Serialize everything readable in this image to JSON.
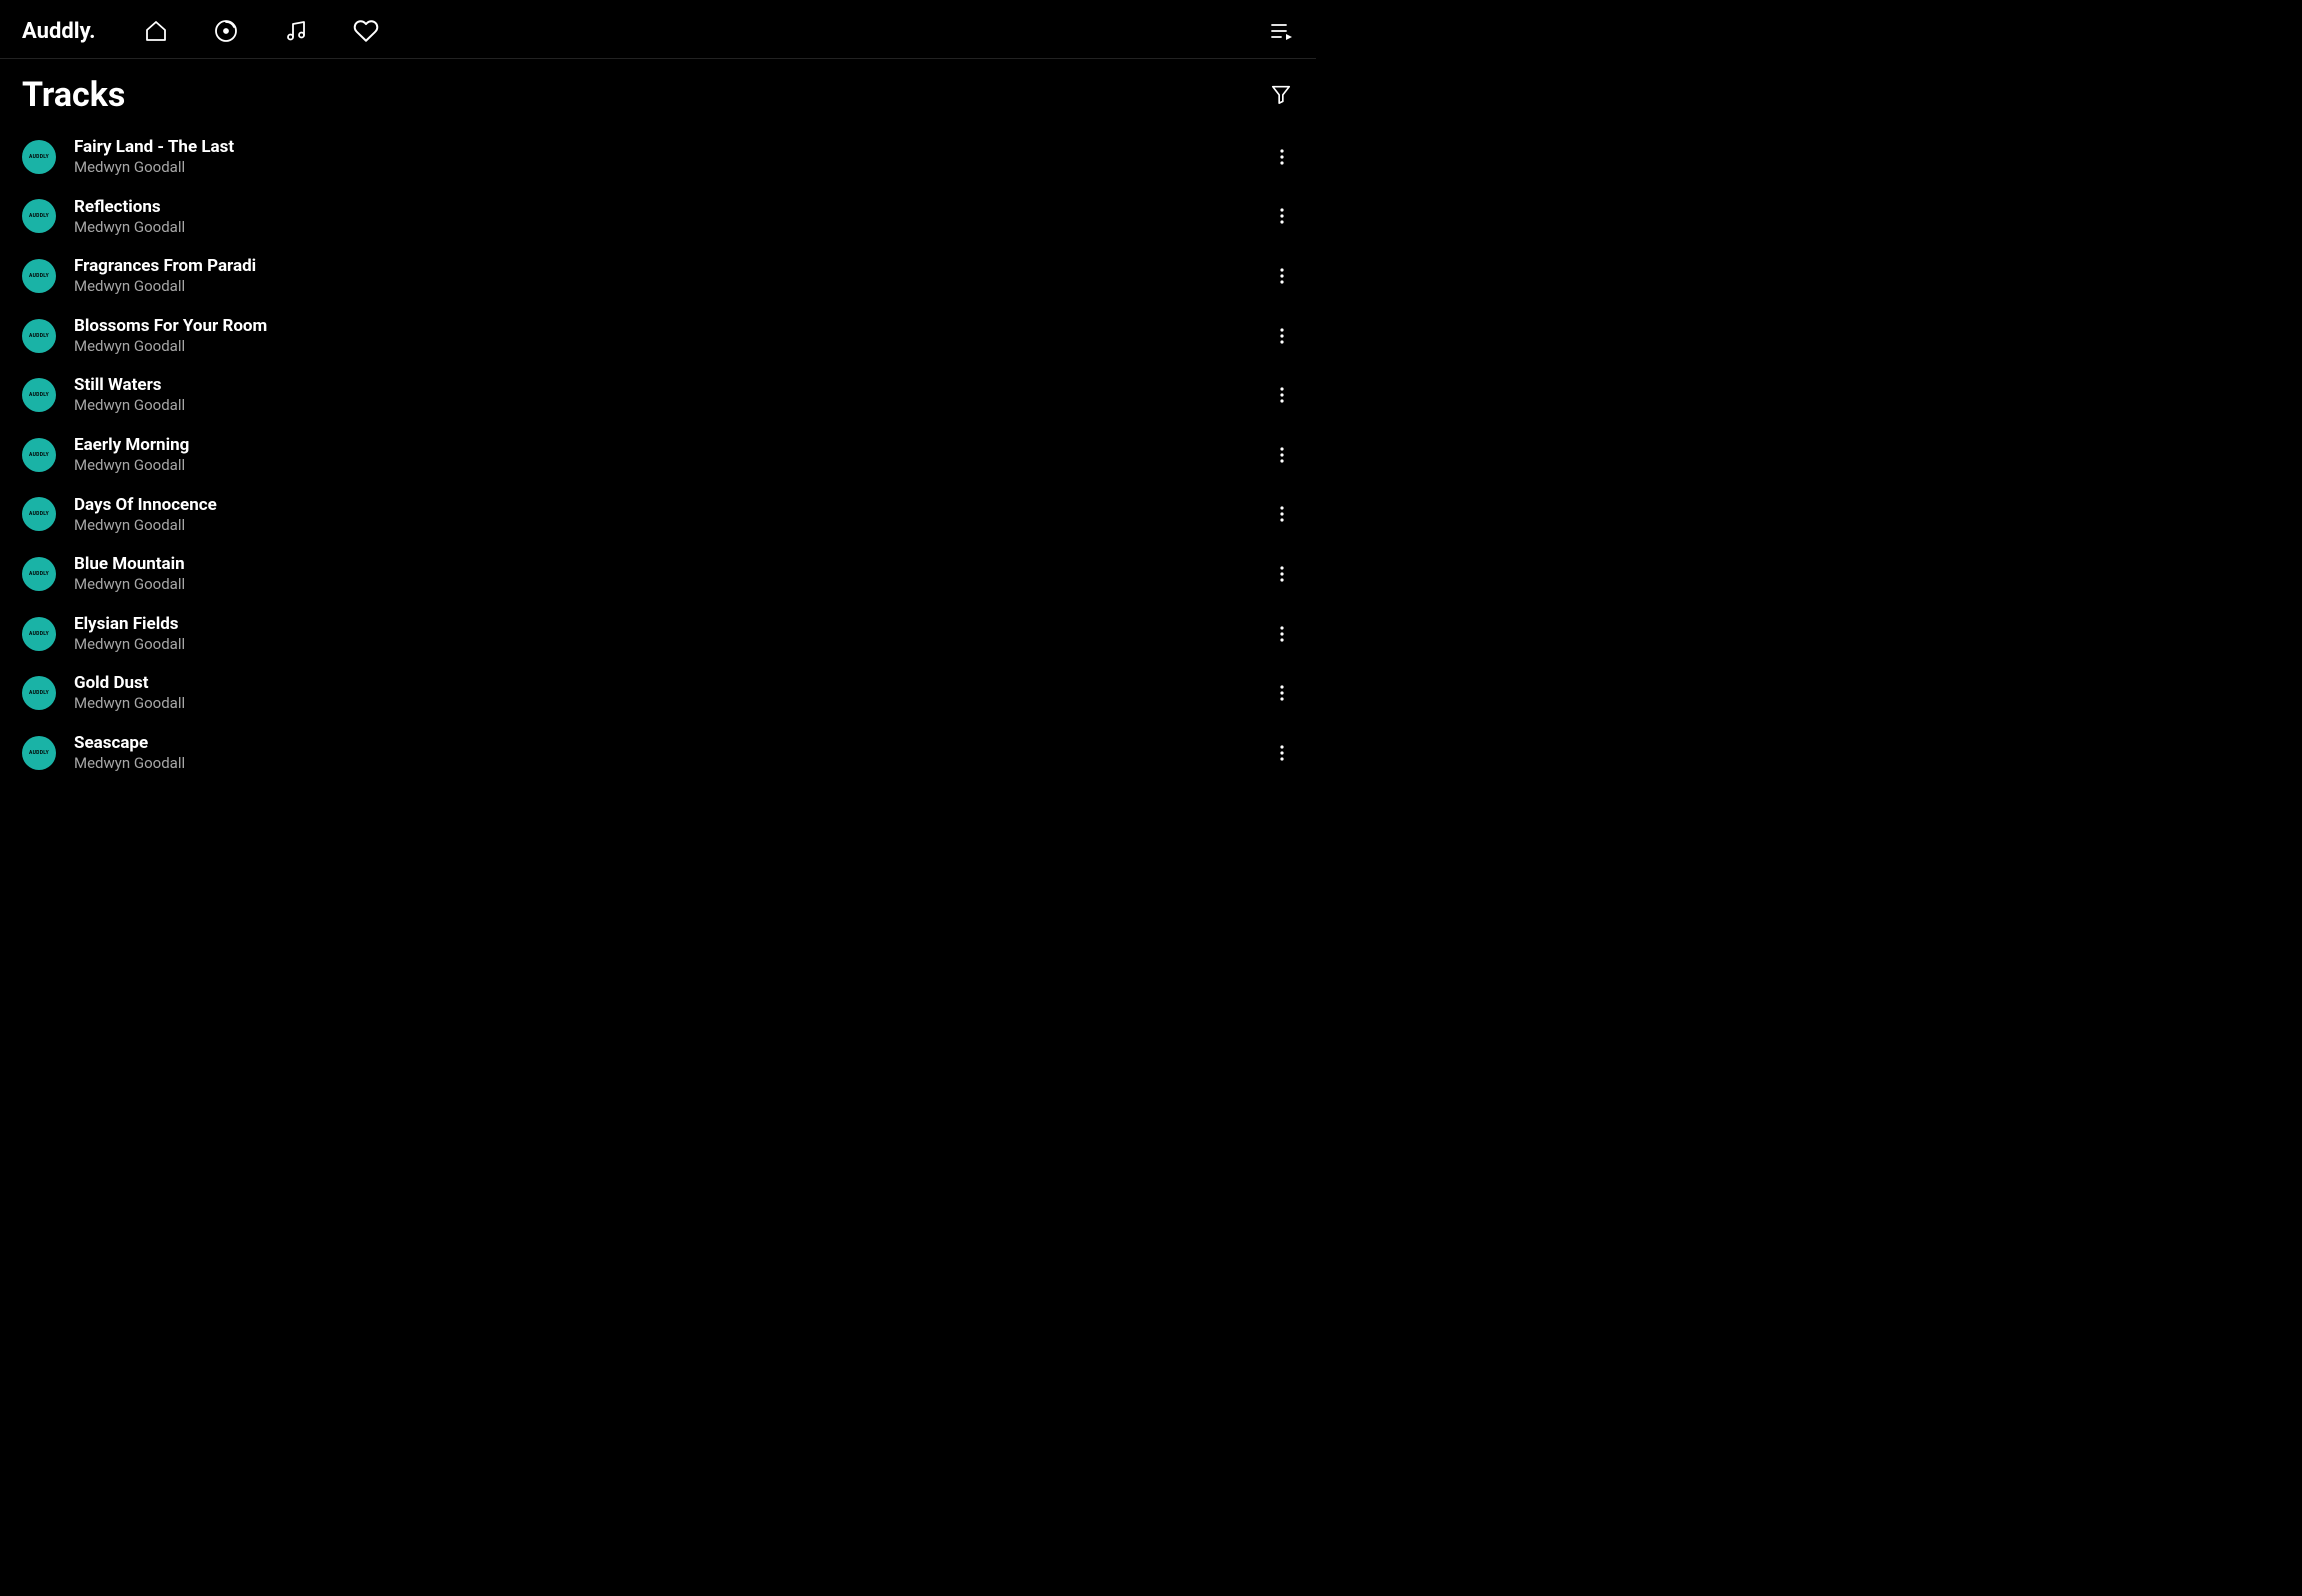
{
  "logo": "Auddly.",
  "page_title": "Tracks",
  "artwork_label": "AUDDLY",
  "tracks": [
    {
      "title": "Fairy Land - The Last",
      "artist": "Medwyn Goodall"
    },
    {
      "title": "Reflections",
      "artist": "Medwyn Goodall"
    },
    {
      "title": "Fragrances From Paradi",
      "artist": "Medwyn Goodall"
    },
    {
      "title": "Blossoms For Your Room",
      "artist": "Medwyn Goodall"
    },
    {
      "title": "Still Waters",
      "artist": "Medwyn Goodall"
    },
    {
      "title": "Eaerly Morning",
      "artist": "Medwyn Goodall"
    },
    {
      "title": "Days Of Innocence",
      "artist": "Medwyn Goodall"
    },
    {
      "title": "Blue Mountain",
      "artist": "Medwyn Goodall"
    },
    {
      "title": "Elysian Fields",
      "artist": "Medwyn Goodall"
    },
    {
      "title": "Gold Dust",
      "artist": "Medwyn Goodall"
    },
    {
      "title": "Seascape",
      "artist": "Medwyn Goodall"
    }
  ]
}
